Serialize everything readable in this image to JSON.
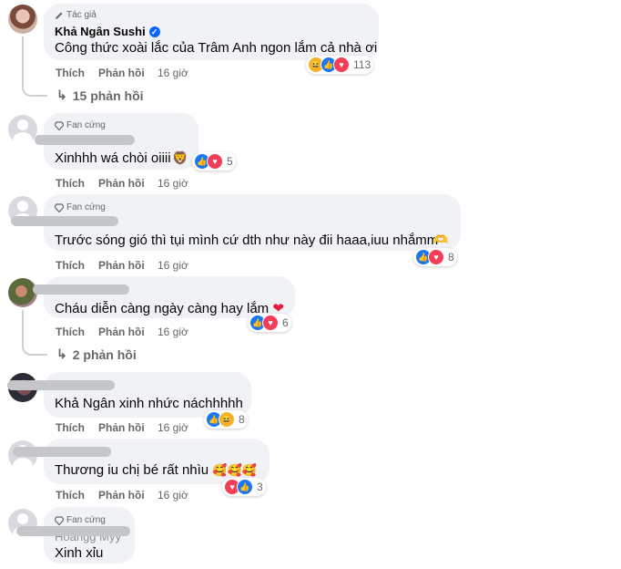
{
  "comments": [
    {
      "badge": "Tác giả",
      "author": "Khả Ngân Sushi",
      "text": "Công thức xoài lắc của Trâm Anh ngon lắm cả nhà ơi",
      "reactions": [
        "haha",
        "like",
        "love"
      ],
      "count": "113",
      "like": "Thích",
      "reply": "Phản hồi",
      "time": "16 giờ",
      "replies": "15 phản hồi"
    },
    {
      "badge": "Fan cứng",
      "text": "Xinhhh wá chòi oiiii",
      "reactions": [
        "like",
        "love"
      ],
      "count": "5",
      "like": "Thích",
      "reply": "Phản hồi",
      "time": "16 giờ"
    },
    {
      "badge": "Fan cứng",
      "text": "Trước sóng gió thì tụi mình cứ dth như này đii haaa,iuu nhắmm",
      "reactions": [
        "like",
        "love"
      ],
      "count": "8",
      "like": "Thích",
      "reply": "Phản hồi",
      "time": "16 giờ"
    },
    {
      "text": "Cháu diễn càng ngày càng hay lắm",
      "reactions": [
        "like",
        "love"
      ],
      "count": "6",
      "like": "Thích",
      "reply": "Phản hồi",
      "time": "16 giờ",
      "replies": "2 phản hồi"
    },
    {
      "text": "Khả Ngân xinh nhức náchhhhh",
      "reactions": [
        "like",
        "haha"
      ],
      "count": "8",
      "like": "Thích",
      "reply": "Phản hồi",
      "time": "16 giờ"
    },
    {
      "text": "Thương iu chị bé rất nhìu",
      "reactions": [
        "love",
        "like"
      ],
      "count": "3",
      "like": "Thích",
      "reply": "Phản hồi",
      "time": "16 giờ"
    },
    {
      "badge": "Fan cứng",
      "author_partial": "Hoangg Myy",
      "text": "Xinh xỉu"
    }
  ],
  "icons": {
    "pencil": "pencil-icon",
    "diamond": "diamond-icon",
    "reply_arrow": "reply-arrow-icon",
    "verified": "verified-icon"
  },
  "colors": {
    "bubble": "#f0f2f5",
    "like": "#1877f2",
    "love": "#f33e58",
    "muted": "#65676b"
  }
}
